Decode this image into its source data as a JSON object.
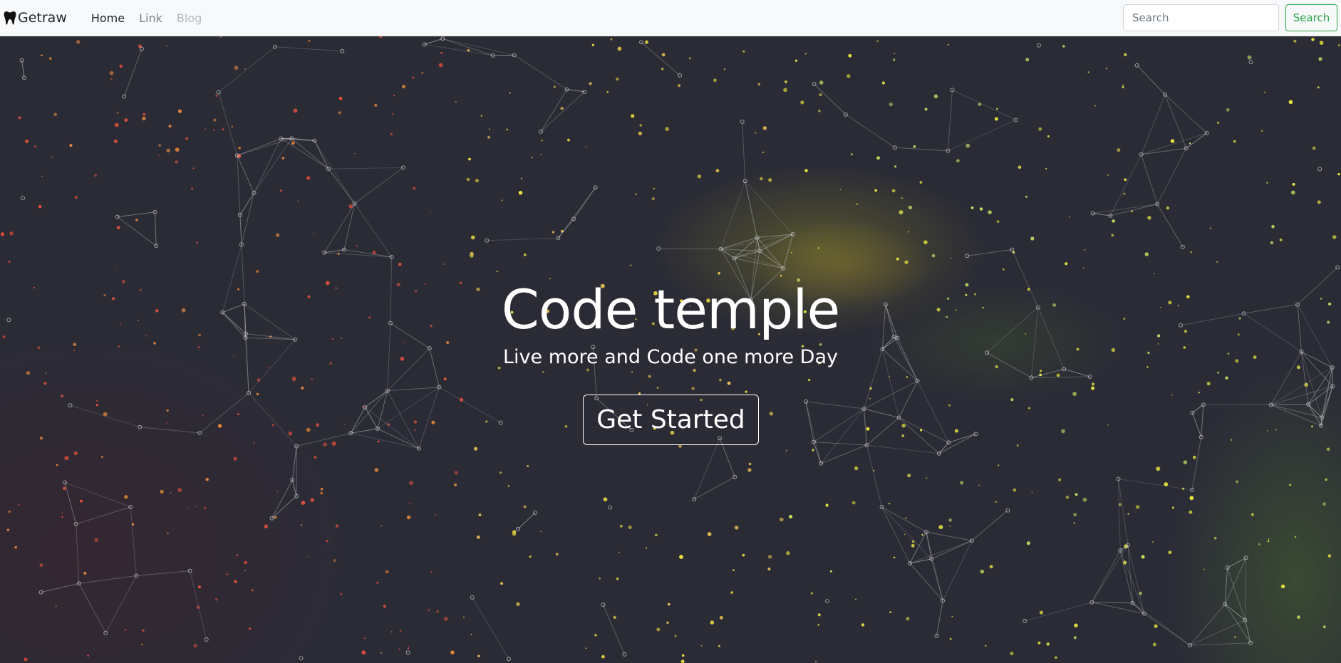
{
  "navbar": {
    "brand_label": "Getraw",
    "brand_icon": "tooth-icon",
    "links": [
      {
        "label": "Home",
        "state": "active"
      },
      {
        "label": "Link",
        "state": "normal"
      },
      {
        "label": "Blog",
        "state": "disabled"
      }
    ],
    "search": {
      "placeholder": "Search",
      "value": "",
      "button_label": "Search"
    }
  },
  "hero": {
    "title": "Code temple",
    "subtitle": "Live more and Code one more Day",
    "cta_label": "Get Started"
  },
  "colors": {
    "navbar_bg": "#f8f9fa",
    "search_accent": "#28a745",
    "hero_bg": "#2b2b36",
    "hero_text": "#ffffff",
    "link_muted": "#7d8288",
    "link_disabled": "#b5b8bc"
  }
}
